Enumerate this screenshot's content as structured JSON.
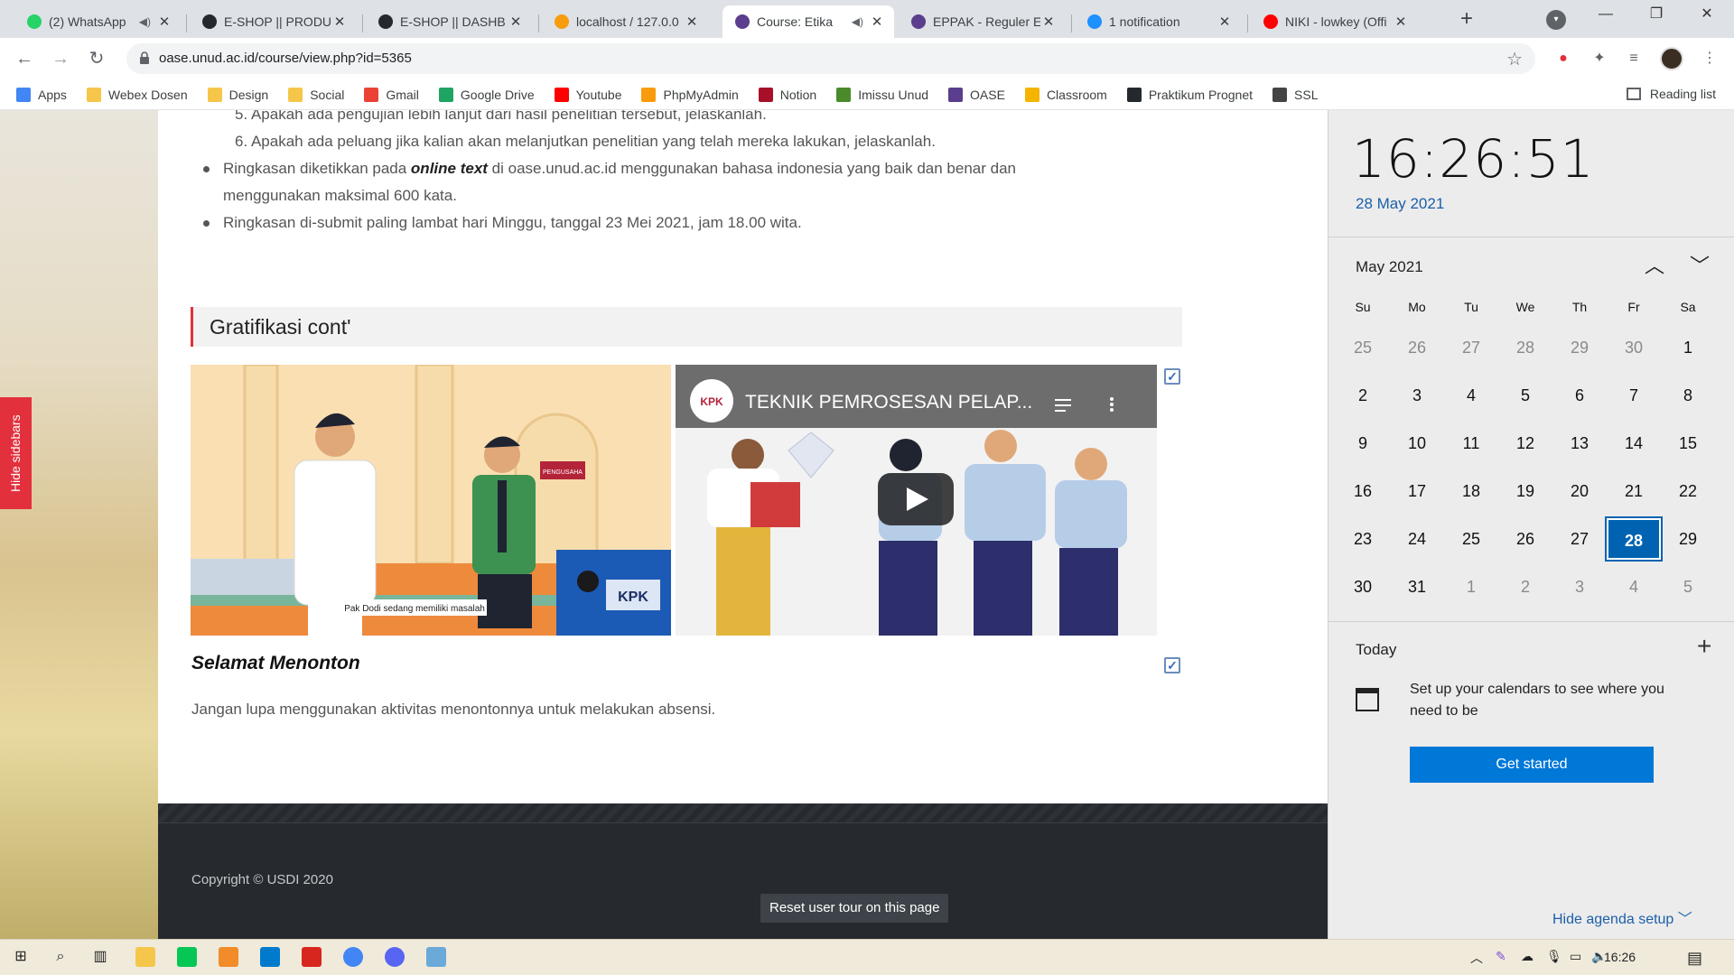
{
  "browser": {
    "tabs": [
      {
        "title": "(2) WhatsApp",
        "icon": "whatsapp-icon",
        "color": "#25d366",
        "speaker": true
      },
      {
        "title": "E-SHOP || PRODU",
        "icon": "github-icon",
        "color": "#24292e"
      },
      {
        "title": "E-SHOP || DASHB",
        "icon": "github-icon",
        "color": "#24292e"
      },
      {
        "title": "localhost / 127.0.0",
        "icon": "phpmyadmin-icon",
        "color": "#f89c0e"
      },
      {
        "title": "Course: Etika",
        "icon": "oase-icon",
        "color": "#5b3e8d",
        "speaker": true
      },
      {
        "title": "EPPAK - Reguler E",
        "icon": "oase-icon",
        "color": "#5b3e8d"
      },
      {
        "title": "1 notification",
        "icon": "chat-icon",
        "color": "#1e90ff"
      },
      {
        "title": "NIKI - lowkey (Offi",
        "icon": "youtube-icon",
        "color": "#ff0000"
      }
    ],
    "url": "oase.unud.ac.id/course/view.php?id=5365",
    "bookmarks": [
      {
        "label": "Apps",
        "icon": "apps-icon",
        "color": "#4285f4"
      },
      {
        "label": "Webex Dosen",
        "icon": "folder-icon",
        "color": "#f6c64a"
      },
      {
        "label": "Design",
        "icon": "folder-icon",
        "color": "#f6c64a"
      },
      {
        "label": "Social",
        "icon": "folder-icon",
        "color": "#f6c64a"
      },
      {
        "label": "Gmail",
        "icon": "gmail-icon",
        "color": "#ea4335"
      },
      {
        "label": "Google Drive",
        "icon": "drive-icon",
        "color": "#1fa463"
      },
      {
        "label": "Youtube",
        "icon": "youtube-icon",
        "color": "#ff0000"
      },
      {
        "label": "PhpMyAdmin",
        "icon": "phpmyadmin-icon",
        "color": "#f89c0e"
      },
      {
        "label": "Notion",
        "icon": "notion-icon",
        "color": "#a8102a"
      },
      {
        "label": "Imissu Unud",
        "icon": "imissu-icon",
        "color": "#4a8a2c"
      },
      {
        "label": "OASE",
        "icon": "oase-icon",
        "color": "#5b3e8d"
      },
      {
        "label": "Classroom",
        "icon": "classroom-icon",
        "color": "#f4b400"
      },
      {
        "label": "Praktikum Prognet",
        "icon": "github-icon",
        "color": "#24292e"
      },
      {
        "label": "SSL",
        "icon": "ssl-icon",
        "color": "#444444"
      }
    ],
    "reading_list": "Reading list"
  },
  "page": {
    "hide_sidebars": "Hide sidebars",
    "numbered": [
      "5. Apakah ada pengujian lebih lanjut dari hasil penelitian tersebut, jelaskanlah.",
      "6. Apakah ada peluang jika kalian akan melanjutkan penelitian yang telah mereka lakukan, jelaskanlah."
    ],
    "bullet1_pre": "Ringkasan diketikkan pada ",
    "bullet1_em": "online text",
    "bullet1_post": " di oase.unud.ac.id menggunakan bahasa indonesia yang baik dan benar dan menggunakan maksimal 600 kata.",
    "bullet2": "Ringkasan di-submit paling lambat hari Minggu, tanggal 23 Mei 2021, jam 18.00 wita.",
    "section_title": "Gratifikasi cont'",
    "image1_caption": "Pak Dodi sedang memiliki masalah",
    "image1_sign": "PENGUSAHA",
    "video_title": "TEKNIK PEMROSESAN PELAP...",
    "video_channel": "KPK",
    "activity_title": "Selamat Menonton",
    "activity_desc": "Jangan lupa menggunakan aktivitas menontonnya untuk melakukan absensi.",
    "copyright": "Copyright © USDI 2020",
    "reset_tour": "Reset user tour on this page"
  },
  "calendar": {
    "time": "16:26:51",
    "date": "28 May 2021",
    "month": "May 2021",
    "weekdays": [
      "Su",
      "Mo",
      "Tu",
      "We",
      "Th",
      "Fr",
      "Sa"
    ],
    "weeks": [
      [
        [
          "25",
          true
        ],
        [
          "26",
          true
        ],
        [
          "27",
          true
        ],
        [
          "28",
          true
        ],
        [
          "29",
          true
        ],
        [
          "30",
          true
        ],
        [
          "1",
          false
        ]
      ],
      [
        [
          "2",
          false
        ],
        [
          "3",
          false
        ],
        [
          "4",
          false
        ],
        [
          "5",
          false
        ],
        [
          "6",
          false
        ],
        [
          "7",
          false
        ],
        [
          "8",
          false
        ]
      ],
      [
        [
          "9",
          false
        ],
        [
          "10",
          false
        ],
        [
          "11",
          false
        ],
        [
          "12",
          false
        ],
        [
          "13",
          false
        ],
        [
          "14",
          false
        ],
        [
          "15",
          false
        ]
      ],
      [
        [
          "16",
          false
        ],
        [
          "17",
          false
        ],
        [
          "18",
          false
        ],
        [
          "19",
          false
        ],
        [
          "20",
          false
        ],
        [
          "21",
          false
        ],
        [
          "22",
          false
        ]
      ],
      [
        [
          "23",
          false
        ],
        [
          "24",
          false
        ],
        [
          "25",
          false
        ],
        [
          "26",
          false
        ],
        [
          "27",
          false
        ],
        [
          "28",
          false
        ],
        [
          "29",
          false
        ]
      ],
      [
        [
          "30",
          false
        ],
        [
          "31",
          false
        ],
        [
          "1",
          true
        ],
        [
          "2",
          true
        ],
        [
          "3",
          true
        ],
        [
          "4",
          true
        ],
        [
          "5",
          true
        ]
      ]
    ],
    "selected_day": "28",
    "today_label": "Today",
    "setup_text": "Set up your calendars to see where you need to be",
    "get_started": "Get started",
    "hide_agenda": "Hide agenda setup"
  },
  "taskbar": {
    "time": "16:26"
  }
}
